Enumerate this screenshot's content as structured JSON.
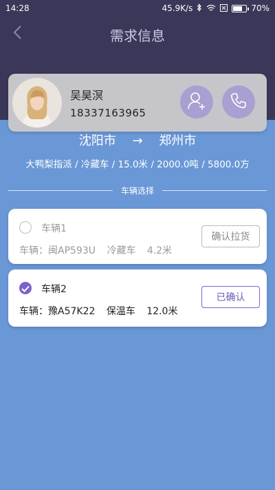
{
  "status_bar": {
    "time": "14:28",
    "network_speed": "45.9K/s",
    "battery_percent": "70%",
    "battery_level": 0.7,
    "icons": [
      "bluetooth-icon",
      "wifi-icon",
      "sim-icon",
      "battery-icon"
    ]
  },
  "header": {
    "title": "需求信息",
    "back_icon": "chevron-left-icon"
  },
  "contact": {
    "name": "吴昊溟",
    "phone": "18337163965",
    "add_icon": "add-contact-icon",
    "call_icon": "phone-icon"
  },
  "route": {
    "origin": "沈阳市",
    "arrow": "→",
    "destination": "郑州市",
    "detail": "大鸭梨指派 / 冷藏车 / 15.0米 / 2000.0吨 / 5800.0方"
  },
  "section": {
    "title": "车辆选择"
  },
  "vehicles": [
    {
      "name": "车辆1",
      "plate_label": "车辆：闽AP593U",
      "type": "冷藏车",
      "length": "4.2米",
      "selected": false,
      "button": "确认拉货"
    },
    {
      "name": "车辆2",
      "plate_label": "车辆：豫A57K22",
      "type": "保温车",
      "length": "12.0米",
      "selected": true,
      "button": "已确认"
    }
  ],
  "colors": {
    "header_bg": "#3a3758",
    "body_bg": "#6a97d6",
    "accent": "#7c62c8",
    "contact_button": "#a99fd0"
  }
}
